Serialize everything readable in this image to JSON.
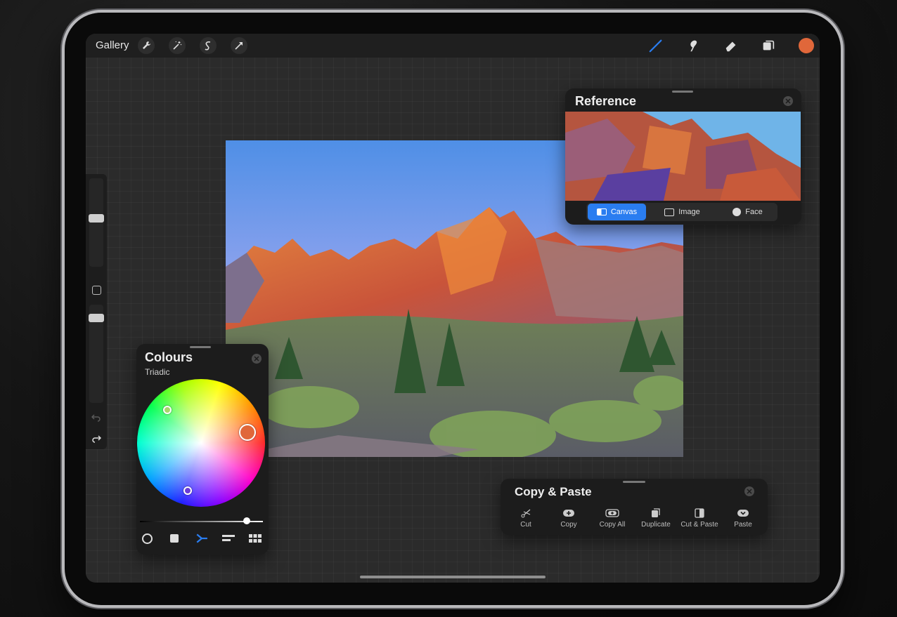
{
  "topbar": {
    "gallery_label": "Gallery",
    "left_tools": [
      "wrench-icon",
      "magic-wand-icon",
      "selection-icon",
      "transform-arrow-icon"
    ],
    "right_tools": [
      "brush-icon",
      "smudge-icon",
      "eraser-icon",
      "layers-icon"
    ],
    "active_tool": "brush-icon",
    "current_color": "#e0673a"
  },
  "reference_panel": {
    "title": "Reference",
    "tabs": [
      {
        "label": "Canvas",
        "icon": "canvas-icon",
        "active": true
      },
      {
        "label": "Image",
        "icon": "image-icon",
        "active": false
      },
      {
        "label": "Face",
        "icon": "face-icon",
        "active": false
      }
    ]
  },
  "colours_panel": {
    "title": "Colours",
    "mode": "Triadic",
    "modes": [
      "disc-icon",
      "classic-icon",
      "harmony-icon",
      "value-icon",
      "palettes-icon"
    ],
    "active_mode": "harmony-icon"
  },
  "copy_paste_panel": {
    "title": "Copy & Paste",
    "actions": [
      {
        "label": "Cut",
        "icon": "scissors-icon"
      },
      {
        "label": "Copy",
        "icon": "copy-icon"
      },
      {
        "label": "Copy All",
        "icon": "copy-all-icon"
      },
      {
        "label": "Duplicate",
        "icon": "duplicate-icon"
      },
      {
        "label": "Cut & Paste",
        "icon": "cut-paste-icon"
      },
      {
        "label": "Paste",
        "icon": "paste-icon"
      }
    ]
  },
  "colors": {
    "accent": "#2a7df0",
    "panel": "#1c1c1c"
  }
}
